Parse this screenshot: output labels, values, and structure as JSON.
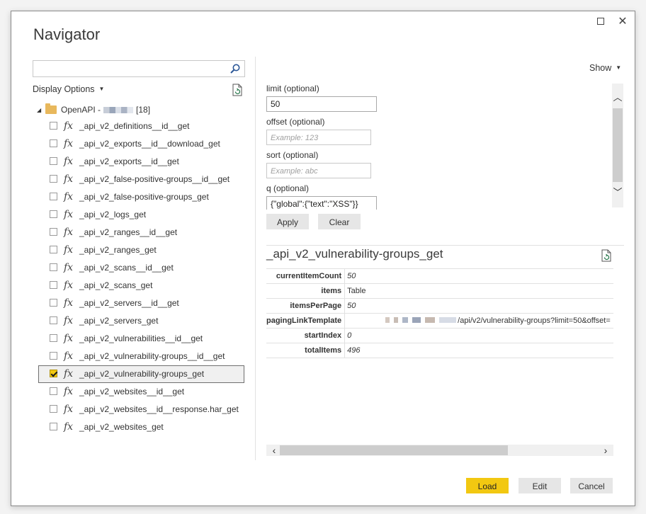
{
  "window": {
    "maximize_label": "",
    "close_label": "✕"
  },
  "title": "Navigator",
  "search": {
    "value": "",
    "placeholder": ""
  },
  "display_options": {
    "label": "Display Options"
  },
  "tree": {
    "root": {
      "label_prefix": "OpenAPI -",
      "count": "[18]"
    },
    "items": [
      {
        "label": "_api_v2_definitions__id__get",
        "checked": false
      },
      {
        "label": "_api_v2_exports__id__download_get",
        "checked": false
      },
      {
        "label": "_api_v2_exports__id__get",
        "checked": false
      },
      {
        "label": "_api_v2_false-positive-groups__id__get",
        "checked": false
      },
      {
        "label": "_api_v2_false-positive-groups_get",
        "checked": false
      },
      {
        "label": "_api_v2_logs_get",
        "checked": false
      },
      {
        "label": "_api_v2_ranges__id__get",
        "checked": false
      },
      {
        "label": "_api_v2_ranges_get",
        "checked": false
      },
      {
        "label": "_api_v2_scans__id__get",
        "checked": false
      },
      {
        "label": "_api_v2_scans_get",
        "checked": false
      },
      {
        "label": "_api_v2_servers__id__get",
        "checked": false
      },
      {
        "label": "_api_v2_servers_get",
        "checked": false
      },
      {
        "label": "_api_v2_vulnerabilities__id__get",
        "checked": false
      },
      {
        "label": "_api_v2_vulnerability-groups__id__get",
        "checked": false
      },
      {
        "label": "_api_v2_vulnerability-groups_get",
        "checked": true
      },
      {
        "label": "_api_v2_websites__id__get",
        "checked": false
      },
      {
        "label": "_api_v2_websites__id__response.har_get",
        "checked": false
      },
      {
        "label": "_api_v2_websites_get",
        "checked": false
      }
    ]
  },
  "show": {
    "label": "Show"
  },
  "params": {
    "limit": {
      "label": "limit (optional)",
      "value": "50",
      "placeholder": ""
    },
    "offset": {
      "label": "offset (optional)",
      "value": "",
      "placeholder": "Example: 123"
    },
    "sort": {
      "label": "sort (optional)",
      "value": "",
      "placeholder": "Example: abc"
    },
    "q": {
      "label": "q (optional)",
      "value": "{\"global\":{\"text\":\"XSS\"}}",
      "placeholder": ""
    }
  },
  "buttons": {
    "apply": "Apply",
    "clear": "Clear",
    "load": "Load",
    "edit": "Edit",
    "cancel": "Cancel"
  },
  "preview": {
    "title": "_api_v2_vulnerability-groups_get",
    "rows": [
      {
        "key": "currentItemCount",
        "value": "50"
      },
      {
        "key": "items",
        "value": "Table"
      },
      {
        "key": "itemsPerPage",
        "value": "50"
      },
      {
        "key": "pagingLinkTemplate",
        "value": "/api/v2/vulnerability-groups?limit=50&offset="
      },
      {
        "key": "startIndex",
        "value": "0"
      },
      {
        "key": "totalItems",
        "value": "496"
      }
    ]
  },
  "colors": {
    "accent": "#f2c811",
    "text": "#252423"
  }
}
